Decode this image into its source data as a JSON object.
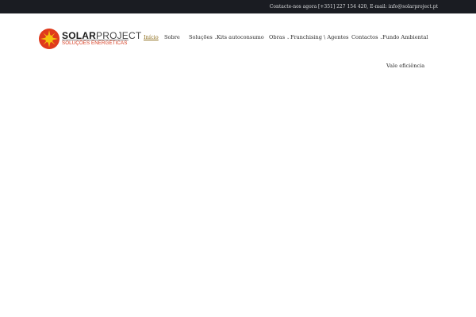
{
  "topbar": {
    "contact_text": "Contacte-nos agora [+351] 227 154 420, E-mail: info@solarproject.pt"
  },
  "logo": {
    "brand_bold": "SOLAR",
    "brand_light": "PROJECT",
    "tagline": "SOLUÇÕES ENERGÉTICAS"
  },
  "nav": {
    "items": [
      {
        "label": "Início"
      },
      {
        "label": "Sobre"
      },
      {
        "label": "Soluções"
      },
      {
        "label": "Kits autoconsumo"
      },
      {
        "label": "Obras"
      },
      {
        "label": "Franchising \\ Agentes"
      },
      {
        "label": "Contactos"
      },
      {
        "label": "Fundo Ambiental"
      },
      {
        "label": "Vale eficiência"
      }
    ],
    "chevron": "⌄"
  },
  "colors": {
    "topbar_bg": "#1a1c22",
    "active_nav": "#8a6a17",
    "tagline": "#d63a1e",
    "sun_outer": "#e03a1c",
    "sun_inner": "#f4c20d"
  }
}
